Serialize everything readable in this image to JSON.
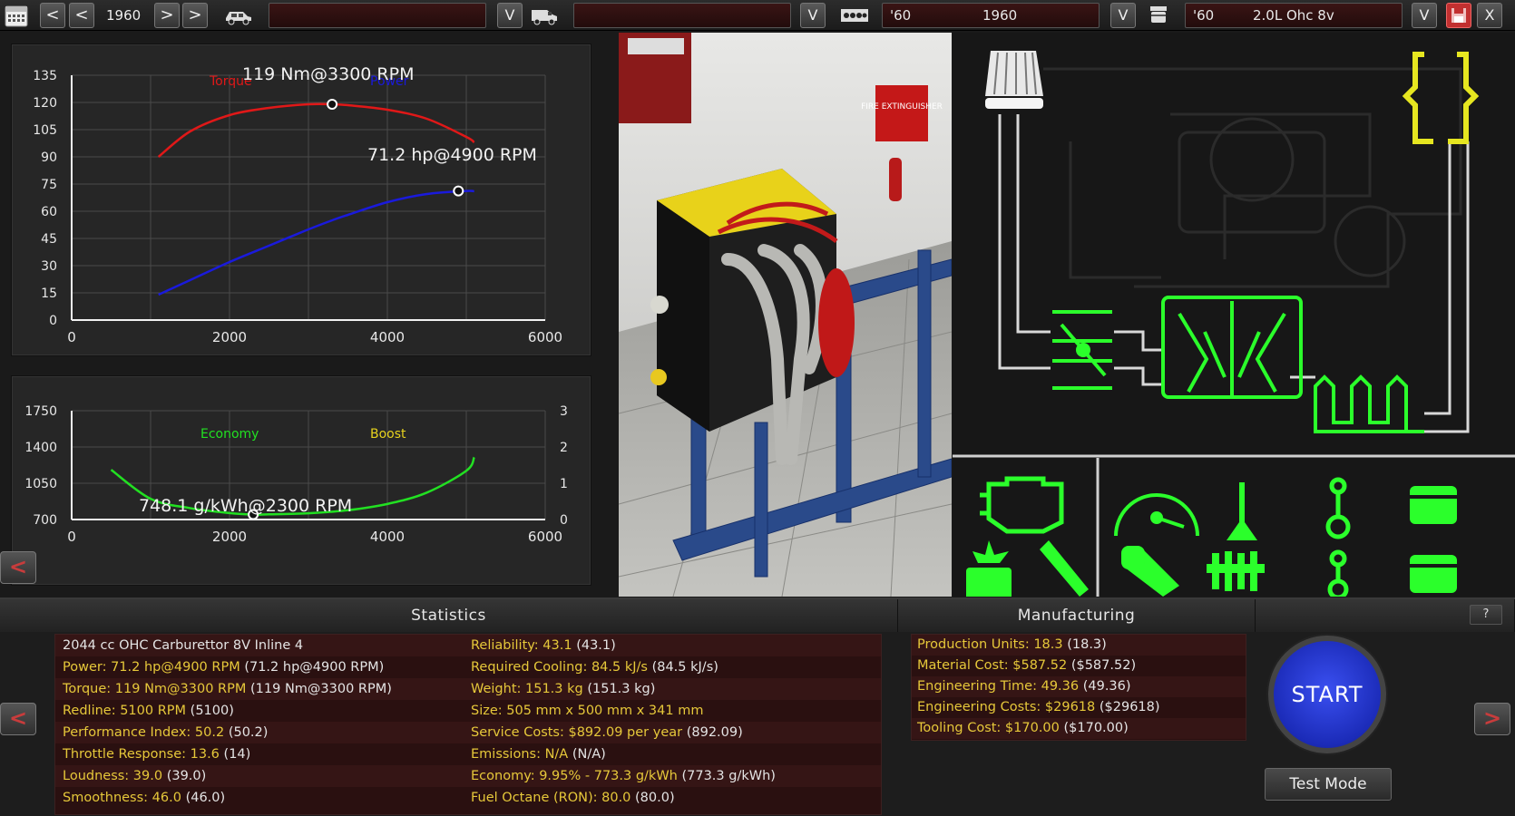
{
  "toolbar": {
    "year": "1960",
    "model_value": "",
    "trim_value": "",
    "engine_family": {
      "short": "'60",
      "year": "1960"
    },
    "engine_variant": {
      "short": "'60",
      "name": "2.0L Ohc 8v"
    },
    "nav": {
      "first": "<",
      "prev": "<",
      "next": ">",
      "last": ">"
    },
    "dropdown": "V",
    "close": "X"
  },
  "charts": {
    "performance": {
      "torque_label": "Torque",
      "power_label": "Power",
      "torque_peak": "119 Nm@3300 RPM",
      "power_peak": "71.2 hp@4900 RPM"
    },
    "economy": {
      "economy_label": "Economy",
      "boost_label": "Boost",
      "economy_peak": "748.1 g/kWh@2300 RPM"
    }
  },
  "chart_data": [
    {
      "type": "line",
      "x": [
        1100,
        1500,
        2000,
        2500,
        3000,
        3300,
        3500,
        4000,
        4500,
        5000,
        5100
      ],
      "series": [
        {
          "name": "Torque",
          "values": [
            90,
            104,
            113,
            117,
            119,
            119,
            118.5,
            116,
            111,
            101,
            98
          ]
        },
        {
          "name": "Power",
          "values": [
            14,
            22,
            32,
            41,
            50,
            55,
            58,
            65,
            69.5,
            71.2,
            71
          ]
        }
      ],
      "xlim": [
        0,
        6000
      ],
      "ylim": [
        0,
        135
      ],
      "x_ticks": [
        0,
        2000,
        4000,
        6000
      ],
      "y_ticks": [
        0,
        15,
        30,
        45,
        60,
        75,
        90,
        105,
        120,
        135
      ],
      "markers": [
        {
          "series": "Torque",
          "x": 3300,
          "y": 119
        },
        {
          "series": "Power",
          "x": 4900,
          "y": 71.2
        }
      ],
      "grid": true,
      "legend": "top"
    },
    {
      "type": "line",
      "x": [
        500,
        1000,
        1500,
        2000,
        2300,
        2500,
        3000,
        3500,
        4000,
        4500,
        5000,
        5100
      ],
      "series": [
        {
          "name": "Economy",
          "values": [
            1180,
            900,
            810,
            762,
            748,
            750,
            760,
            790,
            850,
            960,
            1170,
            1300
          ]
        }
      ],
      "xlim": [
        0,
        6000
      ],
      "ylim": [
        700,
        1750
      ],
      "x_ticks": [
        0,
        2000,
        4000,
        6000
      ],
      "y_ticks": [
        700,
        1050,
        1400,
        1750
      ],
      "y2_ticks": [
        0,
        1,
        2,
        3
      ],
      "markers": [
        {
          "series": "Economy",
          "x": 2300,
          "y": 748.1
        }
      ],
      "grid": true,
      "legend": "top"
    }
  ],
  "left_nav": "<",
  "statistics": {
    "title": "Statistics",
    "rows": [
      {
        "left": {
          "label": "2044 cc OHC Carburettor 8V Inline 4",
          "paren": ""
        },
        "right": {
          "label": "Reliability: 43.1",
          "paren": "(43.1)"
        }
      },
      {
        "left": {
          "label": "Power: 71.2 hp@4900 RPM",
          "paren": "(71.2 hp@4900 RPM)"
        },
        "right": {
          "label": "Required Cooling: 84.5 kJ/s",
          "paren": "(84.5 kJ/s)"
        }
      },
      {
        "left": {
          "label": "Torque: 119 Nm@3300 RPM",
          "paren": "(119 Nm@3300 RPM)"
        },
        "right": {
          "label": "Weight: 151.3 kg",
          "paren": "(151.3 kg)"
        }
      },
      {
        "left": {
          "label": "Redline: 5100 RPM",
          "paren": "(5100)"
        },
        "right": {
          "label": "Size: 505 mm x 500 mm x 341 mm",
          "paren": ""
        }
      },
      {
        "left": {
          "label": "Performance Index: 50.2",
          "paren": "(50.2)"
        },
        "right": {
          "label": "Service Costs: $892.09 per year",
          "paren": "(892.09)"
        }
      },
      {
        "left": {
          "label": "Throttle Response: 13.6",
          "paren": "(14)"
        },
        "right": {
          "label": "Emissions: N/A",
          "paren": "(N/A)"
        }
      },
      {
        "left": {
          "label": "Loudness: 39.0",
          "paren": "(39.0)"
        },
        "right": {
          "label": "Economy: 9.95% - 773.3 g/kWh",
          "paren": "(773.3 g/kWh)"
        }
      },
      {
        "left": {
          "label": "Smoothness: 46.0",
          "paren": "(46.0)"
        },
        "right": {
          "label": "Fuel Octane (RON): 80.0",
          "paren": "(80.0)"
        }
      }
    ]
  },
  "manufacturing": {
    "title": "Manufacturing",
    "rows": [
      {
        "label": "Production Units: 18.3",
        "paren": "(18.3)"
      },
      {
        "label": "Material Cost: $587.52",
        "paren": "($587.52)"
      },
      {
        "label": "Engineering Time: 49.36",
        "paren": "(49.36)"
      },
      {
        "label": "Engineering Costs: $29618",
        "paren": "($29618)"
      },
      {
        "label": "Tooling Cost: $170.00",
        "paren": "($170.00)"
      }
    ]
  },
  "actions": {
    "start": "START",
    "test_mode": "Test Mode",
    "help": "?",
    "prev": "<",
    "next": ">"
  },
  "render": {
    "sign_text": "FIRE EXTINGUISHER"
  },
  "colors": {
    "torque": "#e01818",
    "power": "#1a1adc",
    "economy": "#22e022",
    "boost": "#e6d21e",
    "accent_yellow": "#e6c83a",
    "schematic_green": "#2bff2b"
  },
  "icons": [
    "calendar-icon",
    "car-icon",
    "van-icon",
    "engine-block-icon",
    "piston-icon",
    "save-icon"
  ]
}
